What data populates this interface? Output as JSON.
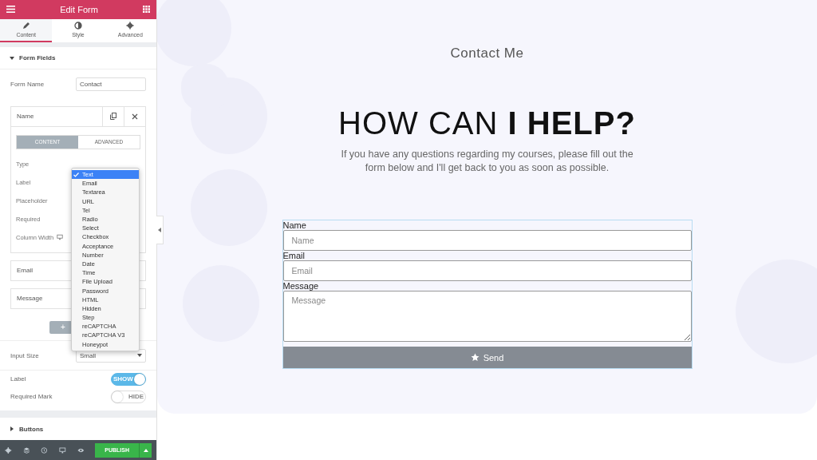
{
  "panel": {
    "title": "Edit Form",
    "tabs": [
      {
        "label": "Content",
        "selected": true
      },
      {
        "label": "Style",
        "selected": false
      },
      {
        "label": "Advanced",
        "selected": false
      }
    ],
    "section": {
      "title": "Form Fields",
      "expanded": true
    },
    "form_name": {
      "label": "Form Name",
      "value": "Contact"
    },
    "items": [
      {
        "label": "Name",
        "expanded": true
      },
      {
        "label": "Email",
        "expanded": false
      },
      {
        "label": "Message",
        "expanded": false
      }
    ],
    "item_tabs": [
      {
        "label": "CONTENT",
        "selected": true
      },
      {
        "label": "ADVANCED",
        "selected": false
      }
    ],
    "item_fields": [
      "Type",
      "Label",
      "Placeholder",
      "Required",
      "Column Width"
    ],
    "type_options": [
      {
        "label": "Text",
        "selected": true
      },
      {
        "label": "Email",
        "selected": false
      },
      {
        "label": "Textarea",
        "selected": false
      },
      {
        "label": "URL",
        "selected": false
      },
      {
        "label": "Tel",
        "selected": false
      },
      {
        "label": "Radio",
        "selected": false
      },
      {
        "label": "Select",
        "selected": false
      },
      {
        "label": "Checkbox",
        "selected": false
      },
      {
        "label": "Acceptance",
        "selected": false
      },
      {
        "label": "Number",
        "selected": false
      },
      {
        "label": "Date",
        "selected": false
      },
      {
        "label": "Time",
        "selected": false
      },
      {
        "label": "File Upload",
        "selected": false
      },
      {
        "label": "Password",
        "selected": false
      },
      {
        "label": "HTML",
        "selected": false
      },
      {
        "label": "Hidden",
        "selected": false
      },
      {
        "label": "Step",
        "selected": false
      },
      {
        "label": "reCAPTCHA",
        "selected": false
      },
      {
        "label": "reCAPTCHA V3",
        "selected": false
      },
      {
        "label": "Honeypot",
        "selected": false
      }
    ],
    "add_button": "+",
    "input_size": {
      "label": "Input Size",
      "value": "Small"
    },
    "switches": [
      {
        "label": "Label",
        "on": true,
        "text": "SHOW"
      },
      {
        "label": "Required Mark",
        "on": false,
        "text": "HIDE"
      }
    ],
    "collapsed_section": {
      "title": "Buttons",
      "expanded": false
    },
    "publish": "PUBLISH"
  },
  "page": {
    "subtitle": "Contact Me",
    "heading": "HOW CAN **I HELP?**",
    "intro": "If you have any questions regarding my courses, please fill out the form below and I'll get back to you as soon as possible.",
    "form": {
      "fields": [
        {
          "label": "Name",
          "placeholder": "Name",
          "kind": "input"
        },
        {
          "label": "Email",
          "placeholder": "Email",
          "kind": "input"
        },
        {
          "label": "Message",
          "placeholder": "Message",
          "kind": "textarea"
        }
      ],
      "button": "Send"
    }
  }
}
